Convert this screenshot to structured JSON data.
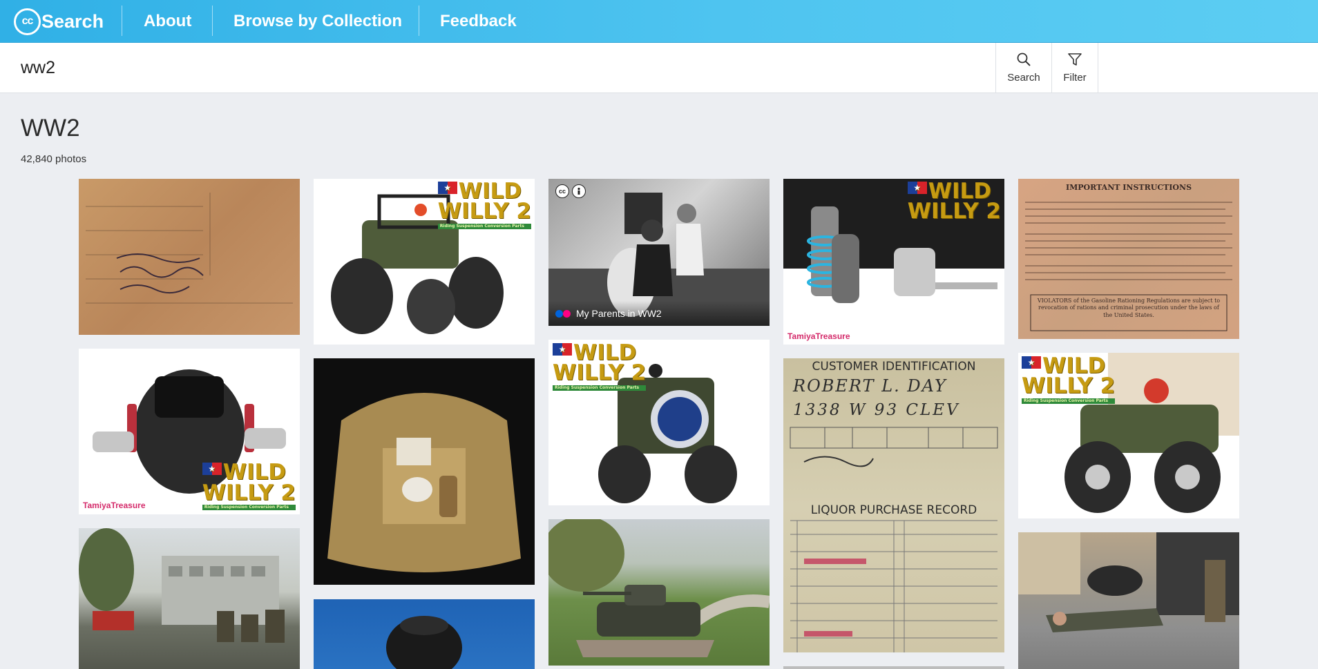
{
  "header": {
    "logo_mark": "cc",
    "logo_word": "Search",
    "nav": [
      "About",
      "Browse by Collection",
      "Feedback"
    ]
  },
  "search": {
    "value": "ww2",
    "buttons": {
      "search_label": "Search",
      "filter_label": "Filter"
    }
  },
  "results": {
    "title": "WW2",
    "count": "42,840 photos"
  },
  "tiles": {
    "ration_folder": {
      "alt": "ration identification folder"
    },
    "willy_jeep": {
      "brand_line1": "WILD",
      "brand_line2": "WILLY 2",
      "brand_sub": "Riding Suspension Conversion Parts"
    },
    "parents_photo": {
      "overlay_title": "My Parents in WW2",
      "license_icons": [
        "cc",
        "by"
      ]
    },
    "shock_detail": {
      "brand_line1": "WILD",
      "brand_line2": "WILLY 2",
      "watermark": "TamiyaTreasure"
    },
    "instructions": {
      "heading": "IMPORTANT INSTRUCTIONS",
      "footer": "VIOLATORS of the Gasoline Rationing Regulations are subject to revocation of rations and criminal prosecution under the laws of the United States."
    },
    "chassis_detail": {
      "brand_line1": "WILD",
      "brand_line2": "WILLY 2",
      "brand_sub": "Riding Suspension Conversion Parts",
      "watermark": "TamiyaTreasure"
    },
    "grooming_kit": {},
    "jeep_front": {
      "brand_line1": "WILD",
      "brand_line2": "WILLY 2",
      "brand_sub": "Riding Suspension Conversion Parts",
      "badge": "WILD WILLY 2"
    },
    "customer_id": {
      "heading": "CUSTOMER IDENTIFICATION",
      "name": "ROBERT L. DAY",
      "address": "1338 W 93 CLEV",
      "record_heading": "LIQUOR PURCHASE RECORD"
    },
    "jeep_side": {
      "brand_line1": "WILD",
      "brand_line2": "WILLY 2",
      "brand_sub": "Riding Suspension Conversion Parts"
    },
    "street_scene": {},
    "helmet_sky": {},
    "tank_monument": {},
    "reenactment": {}
  },
  "colors": {
    "header_start": "#30b0e6",
    "header_end": "#5ccdf3",
    "page_bg": "#eceef2"
  }
}
